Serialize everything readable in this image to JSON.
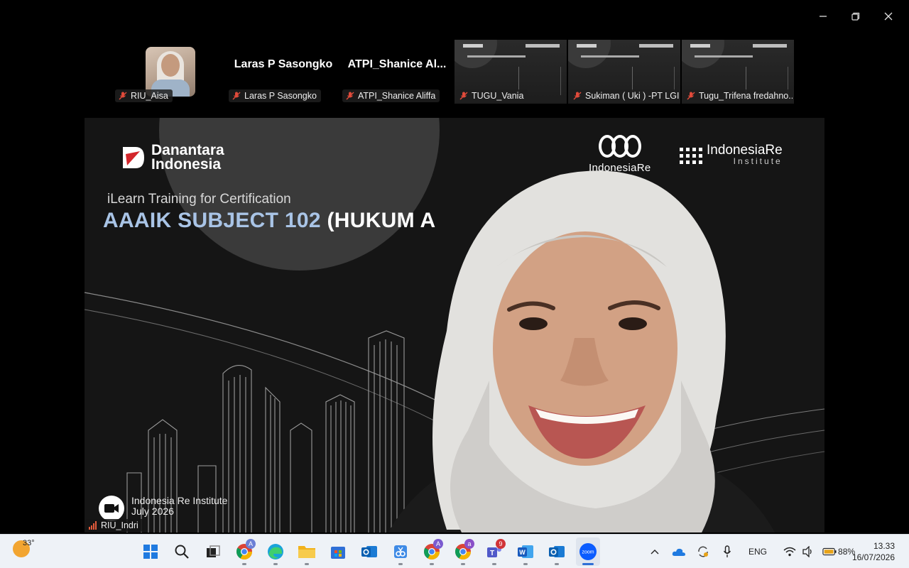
{
  "window_controls": {
    "minimize": "minimize",
    "restore": "restore",
    "close": "close"
  },
  "participants": [
    {
      "label": "RIU_Aisa",
      "type": "avatar"
    },
    {
      "label": "Laras P Sasongko",
      "name_display": "Laras P Sasongko",
      "type": "name"
    },
    {
      "label": "ATPI_Shanice Aliffa",
      "name_display": "ATPI_Shanice  Al...",
      "type": "name"
    },
    {
      "label": "TUGU_Vania",
      "type": "slide"
    },
    {
      "label": "Sukiman ( Uki ) -PT LGI",
      "type": "slide"
    },
    {
      "label": "Tugu_Trifena fredahno...",
      "type": "slide"
    }
  ],
  "slide": {
    "brand_line1": "Danantara",
    "brand_line2": "Indonesia",
    "partner1": "IndonesiaRe",
    "partner2": "IndonesiaRe",
    "partner2_sub": "Institute",
    "subtitle": "iLearn Training for Certification",
    "title_part1": "AAAIK SUBJECT 102",
    "title_part2": " (HUKUM A",
    "footer_line1": "Indonesia Re Institute",
    "footer_line2": "July 2026"
  },
  "active_speaker": {
    "label": "RIU_Indri"
  },
  "taskbar": {
    "weather_temp": "33°",
    "apps": [
      {
        "name": "start-button",
        "icon": "windows-icon"
      },
      {
        "name": "search-button",
        "icon": "search-icon"
      },
      {
        "name": "task-view-button",
        "icon": "task-view-icon"
      },
      {
        "name": "chrome-profile-a",
        "icon": "chrome-icon"
      },
      {
        "name": "edge-button",
        "icon": "edge-icon"
      },
      {
        "name": "file-explorer-button",
        "icon": "folder-icon"
      },
      {
        "name": "store-button",
        "icon": "store-icon"
      },
      {
        "name": "outlook-new-button",
        "icon": "outlook-icon"
      },
      {
        "name": "snipping-tool-button",
        "icon": "snip-icon"
      },
      {
        "name": "chrome-profile-a2",
        "icon": "chrome-icon"
      },
      {
        "name": "chrome-profile-b",
        "icon": "chrome-icon"
      },
      {
        "name": "teams-button",
        "icon": "teams-icon",
        "badge": "9"
      },
      {
        "name": "word-button",
        "icon": "word-icon"
      },
      {
        "name": "outlook-button",
        "icon": "outlook-icon"
      },
      {
        "name": "zoom-button",
        "icon": "zoom-icon",
        "label": "zoom"
      }
    ],
    "tray_language": "ENG",
    "battery": "88%",
    "time": "13.33",
    "date": "16/07/2026"
  },
  "colors": {
    "taskbar_bg": "#eef2f7",
    "title_accent": "#a9c4e6",
    "mic_off": "#e04a3a",
    "zoom_blue": "#0b5cff"
  }
}
